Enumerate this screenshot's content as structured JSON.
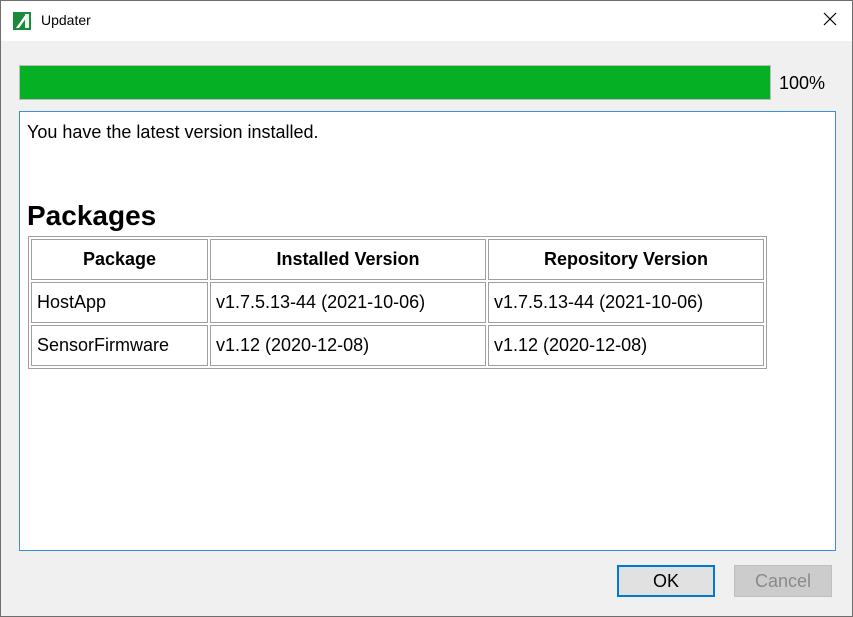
{
  "window": {
    "title": "Updater",
    "app_icon": "updater-logo-icon",
    "close_icon": "close-icon"
  },
  "progress": {
    "fraction": 1.0,
    "label": "100%",
    "fill_color": "#06b025"
  },
  "content": {
    "message": "You have the latest version installed.",
    "packages_heading": "Packages",
    "table": {
      "headers": [
        "Package",
        "Installed Version",
        "Repository Version"
      ],
      "rows": [
        [
          "HostApp",
          "v1.7.5.13-44 (2021-10-06)",
          "v1.7.5.13-44 (2021-10-06)"
        ],
        [
          "SensorFirmware",
          "v1.12 (2020-12-08)",
          "v1.12 (2020-12-08)"
        ]
      ]
    }
  },
  "buttons": {
    "ok_label": "OK",
    "cancel_label": "Cancel"
  },
  "colors": {
    "accent": "#0078d7",
    "content_border": "#3c8ce0"
  }
}
